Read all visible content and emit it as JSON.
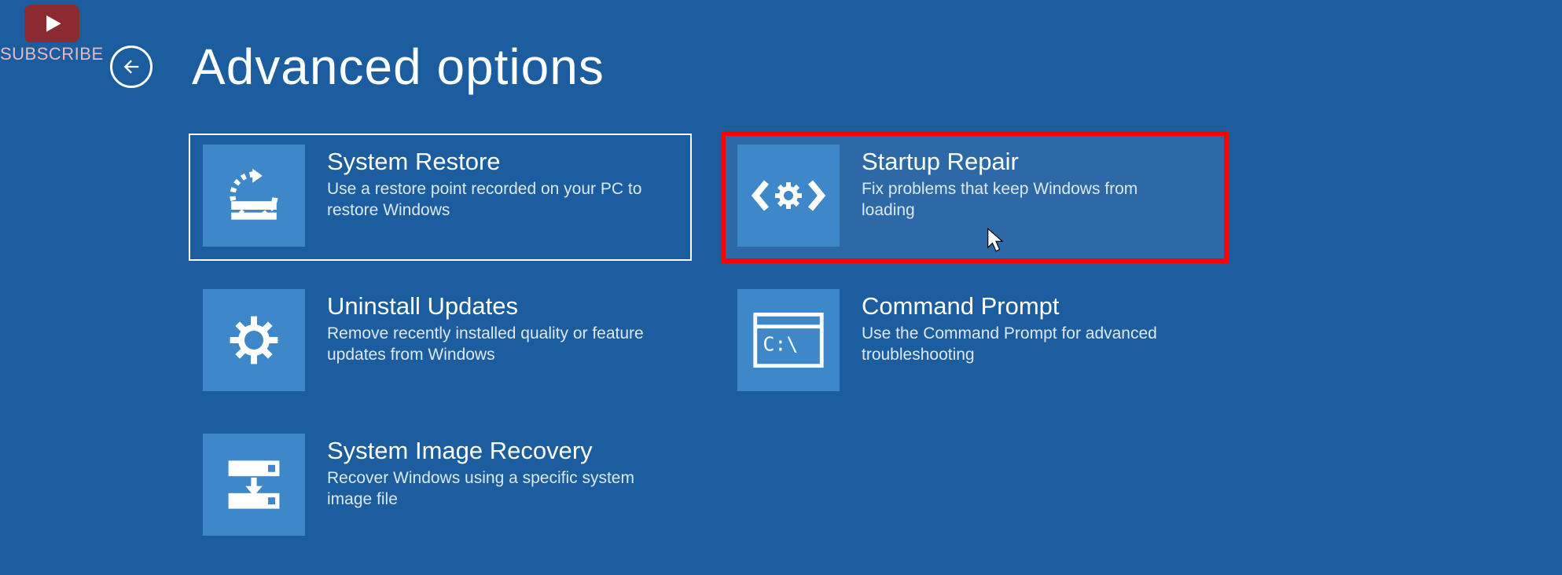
{
  "watermark": {
    "subscribe": "SUBSCRIBE"
  },
  "page": {
    "title": "Advanced options"
  },
  "options": {
    "system_restore": {
      "title": "System Restore",
      "desc": "Use a restore point recorded on your PC to restore Windows"
    },
    "startup_repair": {
      "title": "Startup Repair",
      "desc": "Fix problems that keep Windows from loading"
    },
    "uninstall_updates": {
      "title": "Uninstall Updates",
      "desc": "Remove recently installed quality or feature updates from Windows"
    },
    "command_prompt": {
      "title": "Command Prompt",
      "desc": "Use the Command Prompt for advanced troubleshooting"
    },
    "system_image_recovery": {
      "title": "System Image Recovery",
      "desc": "Recover Windows using a specific system image file"
    }
  }
}
